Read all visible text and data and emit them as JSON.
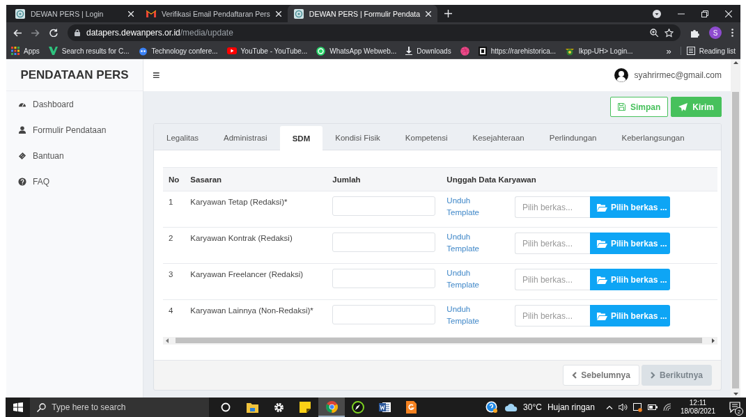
{
  "browser": {
    "tabs": [
      {
        "title": "DEWAN PERS | Login",
        "selected": false
      },
      {
        "title": "Verifikasi Email Pendaftaran Pers",
        "selected": false
      },
      {
        "title": "DEWAN PERS | Formulir Pendata",
        "selected": true
      }
    ],
    "address": {
      "host": "datapers.dewanpers.or.id",
      "path": "/media/update"
    },
    "profile_initial": "S",
    "bookmarks": [
      "Apps",
      "Search results for C...",
      "Technology confere...",
      "YouTube - YouTube...",
      "WhatsApp Webweb...",
      "Downloads",
      "https://rarehistorica...",
      "lkpp-UH> Login..."
    ],
    "more": "»",
    "reading_list": "Reading list"
  },
  "sidebar": {
    "brand": "PENDATAAN PERS",
    "items": [
      "Dashboard",
      "Formulir Pendataan",
      "Bantuan",
      "FAQ"
    ]
  },
  "header": {
    "menu": "≡",
    "user": "syahrirmec@gmail.com"
  },
  "actions": [
    {
      "label": "Simpan",
      "kind": "outline"
    },
    {
      "label": "Kirim",
      "kind": "solid"
    }
  ],
  "tabs": [
    {
      "label": "Legalitas",
      "selected": false
    },
    {
      "label": "Administrasi",
      "selected": false
    },
    {
      "label": "SDM",
      "selected": true
    },
    {
      "label": "Kondisi Fisik",
      "selected": false
    },
    {
      "label": "Kompetensi",
      "selected": false
    },
    {
      "label": "Kesejahteraan",
      "selected": false
    },
    {
      "label": "Perlindungan",
      "selected": false
    },
    {
      "label": "Keberlangsungan",
      "selected": false
    }
  ],
  "table": {
    "columns": [
      "No",
      "Sasaran",
      "Jumlah",
      "Unggah Data Karyawan"
    ],
    "rows": [
      {
        "no": "1",
        "sasaran": "Karyawan Tetap (Redaksi)*",
        "link": "Unduh Template",
        "file_placeholder": "Pilih berkas...",
        "button": "Pilih berkas ..."
      },
      {
        "no": "2",
        "sasaran": "Karyawan Kontrak (Redaksi)",
        "link": "Unduh Template",
        "file_placeholder": "Pilih berkas...",
        "button": "Pilih berkas ..."
      },
      {
        "no": "3",
        "sasaran": "Karyawan Freelancer (Redaksi)",
        "link": "Unduh Template",
        "file_placeholder": "Pilih berkas...",
        "button": "Pilih berkas ..."
      },
      {
        "no": "4",
        "sasaran": "Karyawan Lainnya (Non-Redaksi)*",
        "link": "Unduh Template",
        "file_placeholder": "Pilih berkas...",
        "button": "Pilih berkas ..."
      }
    ]
  },
  "pager": [
    {
      "label": "Sebelumnya",
      "kind": "prev",
      "disabled": false
    },
    {
      "label": "Berikutnya",
      "kind": "next",
      "disabled": true
    }
  ],
  "taskbar": {
    "search_placeholder": "Type here to search",
    "apps": [
      {
        "active": false
      },
      {
        "active": false
      },
      {
        "active": false
      },
      {
        "active": false
      },
      {
        "active": true
      },
      {
        "active": false
      },
      {
        "active": false
      },
      {
        "active": false
      },
      {
        "active": false
      }
    ],
    "temperature": "30°C",
    "weather": "Hujan ringan",
    "time": "12:11",
    "date": "18/08/2021",
    "notifications": "2"
  }
}
